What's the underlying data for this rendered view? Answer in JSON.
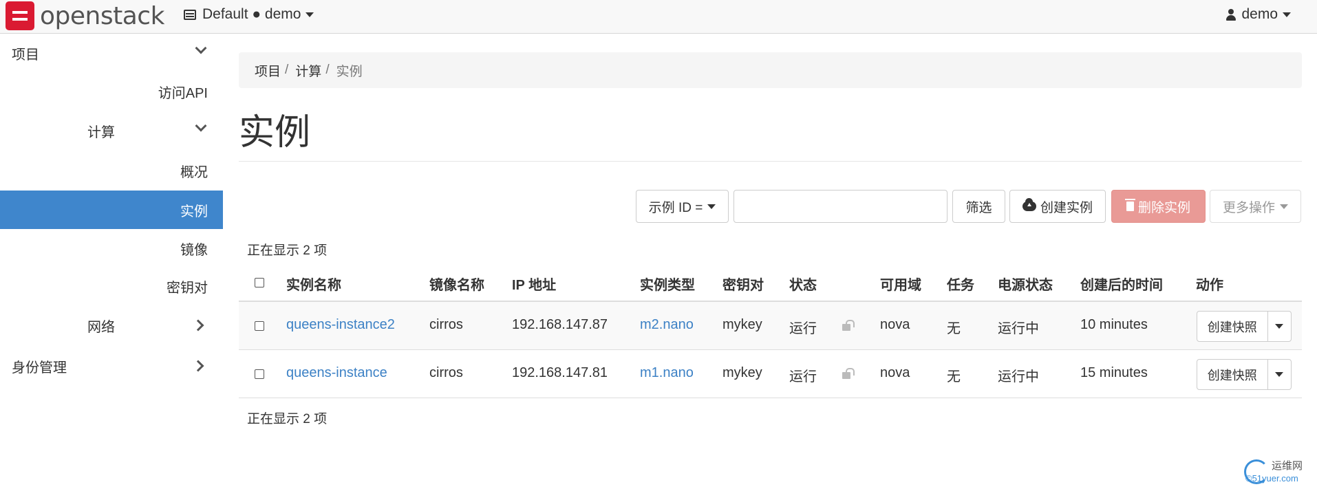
{
  "brand": {
    "name": "openstack"
  },
  "navbar": {
    "project_label": "Default ● demo",
    "user_label": "demo"
  },
  "sidebar": {
    "items": [
      {
        "label": "项目"
      },
      {
        "label": "访问API"
      },
      {
        "label": "计算"
      },
      {
        "label": "概况"
      },
      {
        "label": "实例"
      },
      {
        "label": "镜像"
      },
      {
        "label": "密钥对"
      },
      {
        "label": "网络"
      },
      {
        "label": "身份管理"
      }
    ]
  },
  "breadcrumb": {
    "items": [
      "项目",
      "计算",
      "实例"
    ],
    "separator": "/"
  },
  "page": {
    "title": "实例"
  },
  "toolbar": {
    "filter_select": "示例 ID =",
    "filter_input_value": "",
    "filter_button": "筛选",
    "create_button": "创建实例",
    "delete_button": "删除实例",
    "more_button": "更多操作"
  },
  "table": {
    "count_text": "正在显示 2 项",
    "headers": [
      "实例名称",
      "镜像名称",
      "IP 地址",
      "实例类型",
      "密钥对",
      "状态",
      "可用域",
      "任务",
      "电源状态",
      "创建后的时间",
      "动作"
    ],
    "rows": [
      {
        "name": "queens-instance2",
        "image": "cirros",
        "ip": "192.168.147.87",
        "flavor": "m2.nano",
        "keypair": "mykey",
        "status": "运行",
        "az": "nova",
        "task": "无",
        "power": "运行中",
        "age": "10 minutes",
        "action": "创建快照"
      },
      {
        "name": "queens-instance",
        "image": "cirros",
        "ip": "192.168.147.81",
        "flavor": "m1.nano",
        "keypair": "mykey",
        "status": "运行",
        "az": "nova",
        "task": "无",
        "power": "运行中",
        "age": "15 minutes",
        "action": "创建快照"
      }
    ]
  },
  "watermark": {
    "line1": "运维网",
    "line2": "©51yuer.com"
  },
  "colors": {
    "accent": "#3f86cc",
    "link": "#3c81c5",
    "danger": "#e99a96",
    "brand": "#da1a32"
  }
}
